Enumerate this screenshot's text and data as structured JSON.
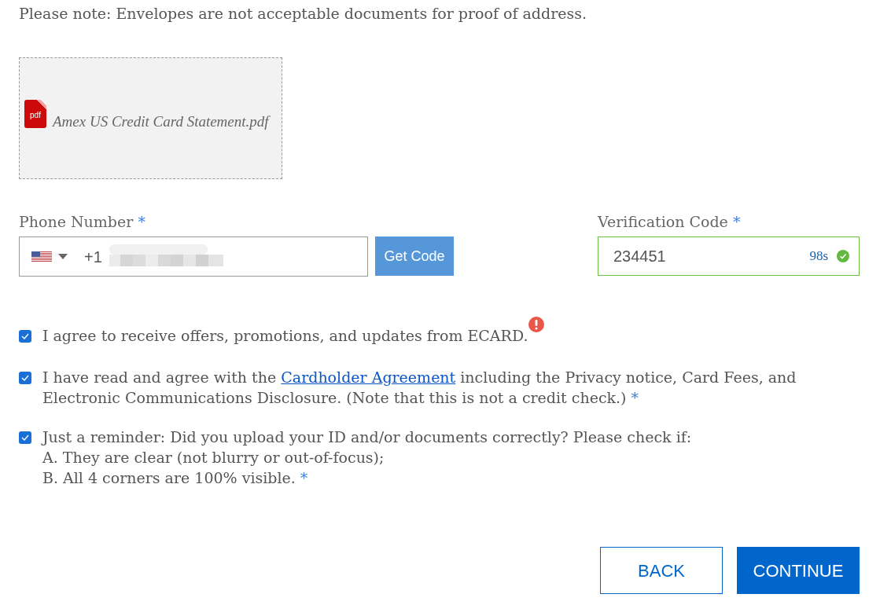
{
  "notice": "Please note: Envelopes are not acceptable documents for proof of address.",
  "upload": {
    "file_type": "pdf",
    "file_name": "Amex US Credit Card Statement.pdf"
  },
  "phone": {
    "label": "Phone Number",
    "required_mark": "*",
    "country_code": "+1",
    "button": "Get Code"
  },
  "verification": {
    "label": "Verification Code",
    "required_mark": "*",
    "value": "234451",
    "countdown": "98s",
    "verified": true
  },
  "agreements": [
    {
      "kind": "text",
      "checked": true,
      "error": true,
      "text": "I agree to receive offers, promotions, and updates from ECARD."
    },
    {
      "kind": "linked",
      "checked": true,
      "error": false,
      "text_before": "I have read and agree with the",
      "link": "Cardholder Agreement",
      "text_after": "including the Privacy notice, Card Fees, and Electronic Communications Disclosure. (Note that this is not a credit check.)",
      "required_mark": "*"
    },
    {
      "kind": "lines",
      "checked": true,
      "error": false,
      "lines": [
        "Just a reminder: Did you upload your ID and/or documents correctly? Please check if:",
        "A. They are clear (not blurry or out-of-focus);",
        "B. All 4 corners are 100% visible."
      ],
      "required_mark": "*"
    }
  ],
  "buttons": {
    "back": "BACK",
    "continue": "CONTINUE"
  }
}
